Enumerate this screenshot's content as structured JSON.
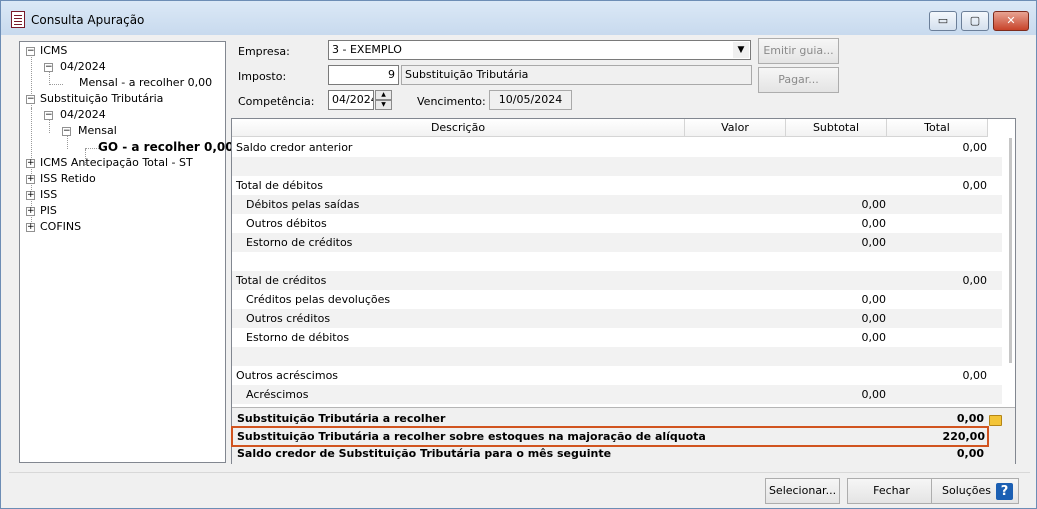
{
  "window": {
    "title": "Consulta Apuração",
    "minimize_glyph": "▭",
    "maximize_glyph": "▢",
    "close_glyph": "✕"
  },
  "tree": {
    "nodes": [
      {
        "label": "ICMS",
        "toggle": "−"
      },
      {
        "label": "04/2024",
        "toggle": "−"
      },
      {
        "label": "Mensal - a recolher 0,00"
      },
      {
        "label": "Substituição Tributária",
        "toggle": "−"
      },
      {
        "label": "04/2024",
        "toggle": "−"
      },
      {
        "label": "Mensal",
        "toggle": "−"
      },
      {
        "label": "GO  - a recolher 0,00"
      },
      {
        "label": "ICMS Antecipação Total - ST",
        "toggle": "+"
      },
      {
        "label": "ISS Retido",
        "toggle": "+"
      },
      {
        "label": "ISS",
        "toggle": "+"
      },
      {
        "label": "PIS",
        "toggle": "+"
      },
      {
        "label": "COFINS",
        "toggle": "+"
      }
    ]
  },
  "form": {
    "empresa_label": "Empresa:",
    "empresa_value": "3 - EXEMPLO",
    "imposto_label": "Imposto:",
    "imposto_code": "9",
    "imposto_name": "Substituição Tributária",
    "competencia_label": "Competência:",
    "competencia_value": "04/2024",
    "vencimento_label": "Vencimento:",
    "vencimento_value": "10/05/2024"
  },
  "side_buttons": {
    "emitir_guia": "Emitir guia...",
    "pagar": "Pagar..."
  },
  "grid": {
    "columns": [
      "Descrição",
      "Valor",
      "Subtotal",
      "Total"
    ],
    "rows": [
      {
        "descricao": "Saldo credor anterior",
        "indent": 0,
        "valor": "",
        "subtotal": "",
        "total": "0,00"
      },
      {
        "descricao": "",
        "indent": 0,
        "valor": "",
        "subtotal": "",
        "total": ""
      },
      {
        "descricao": "Total de débitos",
        "indent": 0,
        "valor": "",
        "subtotal": "",
        "total": "0,00"
      },
      {
        "descricao": "Débitos pelas saídas",
        "indent": 1,
        "valor": "",
        "subtotal": "0,00",
        "total": ""
      },
      {
        "descricao": "Outros débitos",
        "indent": 1,
        "valor": "",
        "subtotal": "0,00",
        "total": ""
      },
      {
        "descricao": "Estorno de créditos",
        "indent": 1,
        "valor": "",
        "subtotal": "0,00",
        "total": ""
      },
      {
        "descricao": "",
        "indent": 0,
        "valor": "",
        "subtotal": "",
        "total": ""
      },
      {
        "descricao": "Total de créditos",
        "indent": 0,
        "valor": "",
        "subtotal": "",
        "total": "0,00"
      },
      {
        "descricao": "Créditos pelas devoluções",
        "indent": 1,
        "valor": "",
        "subtotal": "0,00",
        "total": ""
      },
      {
        "descricao": "Outros créditos",
        "indent": 1,
        "valor": "",
        "subtotal": "0,00",
        "total": ""
      },
      {
        "descricao": "Estorno de débitos",
        "indent": 1,
        "valor": "",
        "subtotal": "0,00",
        "total": ""
      },
      {
        "descricao": "",
        "indent": 0,
        "valor": "",
        "subtotal": "",
        "total": ""
      },
      {
        "descricao": "Outros acréscimos",
        "indent": 0,
        "valor": "",
        "subtotal": "",
        "total": "0,00"
      },
      {
        "descricao": "Acréscimos",
        "indent": 1,
        "valor": "",
        "subtotal": "0,00",
        "total": ""
      }
    ]
  },
  "totals": [
    {
      "label": "Substituição Tributária a recolher",
      "value": "0,00"
    },
    {
      "label": "Substituição Tributária a recolher sobre estoques na majoração de alíquota",
      "value": "220,00"
    },
    {
      "label": "Saldo credor de Substituição Tributária para o mês seguinte",
      "value": "0,00"
    }
  ],
  "buttons": {
    "selecionar": "Selecionar...",
    "fechar": "Fechar",
    "solucoes": "Soluções",
    "help_glyph": "?"
  },
  "colors": {
    "highlight_outline": "#d1541f",
    "help_icon": "#1b5fb3"
  }
}
